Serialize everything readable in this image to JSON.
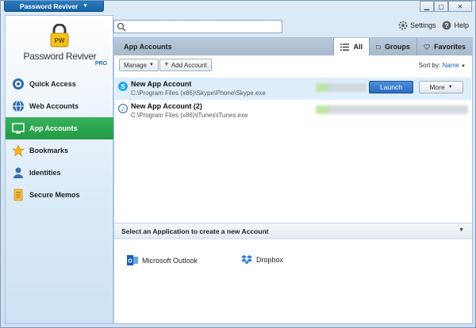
{
  "window": {
    "app_menu_label": "Password Reviver",
    "controls": [
      "minimize",
      "maximize",
      "close"
    ]
  },
  "logo": {
    "lock_text": "PW",
    "name": "Password Reviver",
    "edition": "PRO"
  },
  "sidebar": {
    "items": [
      {
        "label": "Quick Access",
        "icon": "quick-access-icon",
        "active": false
      },
      {
        "label": "Web Accounts",
        "icon": "globe-icon",
        "active": false
      },
      {
        "label": "App Accounts",
        "icon": "monitor-icon",
        "active": true
      },
      {
        "label": "Bookmarks",
        "icon": "star-icon",
        "active": false
      },
      {
        "label": "Identities",
        "icon": "person-icon",
        "active": false
      },
      {
        "label": "Secure Memos",
        "icon": "memo-icon",
        "active": false
      }
    ]
  },
  "search": {
    "value": "",
    "placeholder": ""
  },
  "header": {
    "settings_label": "Settings",
    "help_label": "Help"
  },
  "content": {
    "title": "App Accounts",
    "tabs": [
      {
        "label": "All",
        "icon": "list-icon",
        "selected": true
      },
      {
        "label": "Groups",
        "icon": "folder-icon",
        "selected": false
      },
      {
        "label": "Favorites",
        "icon": "heart-icon",
        "selected": false
      }
    ],
    "toolbar": {
      "manage_label": "Manage",
      "add_label": "Add Account",
      "sort_prefix": "Sort by:",
      "sort_value": "Name"
    },
    "accounts": [
      {
        "name": "New App Account",
        "path": "C:\\Program Files (x86)\\Skype\\Phone\\Skype.exe",
        "icon": "skype-icon",
        "selected": true
      },
      {
        "name": "New App Account (2)",
        "path": "C:\\Program Files (x86)\\iTunes\\iTunes.exe",
        "icon": "itunes-icon",
        "selected": false
      }
    ],
    "launch_label": "Launch",
    "more_label": "More",
    "bottom": {
      "title": "Select an Application to create a new Account",
      "apps": [
        {
          "label": "Microsoft Outlook",
          "icon": "outlook-icon"
        },
        {
          "label": "Dropbox",
          "icon": "dropbox-icon"
        }
      ]
    }
  },
  "colors": {
    "accent_green": "#229a45",
    "launch_blue": "#2c6cc0",
    "selected_row": "#dfeefb"
  }
}
